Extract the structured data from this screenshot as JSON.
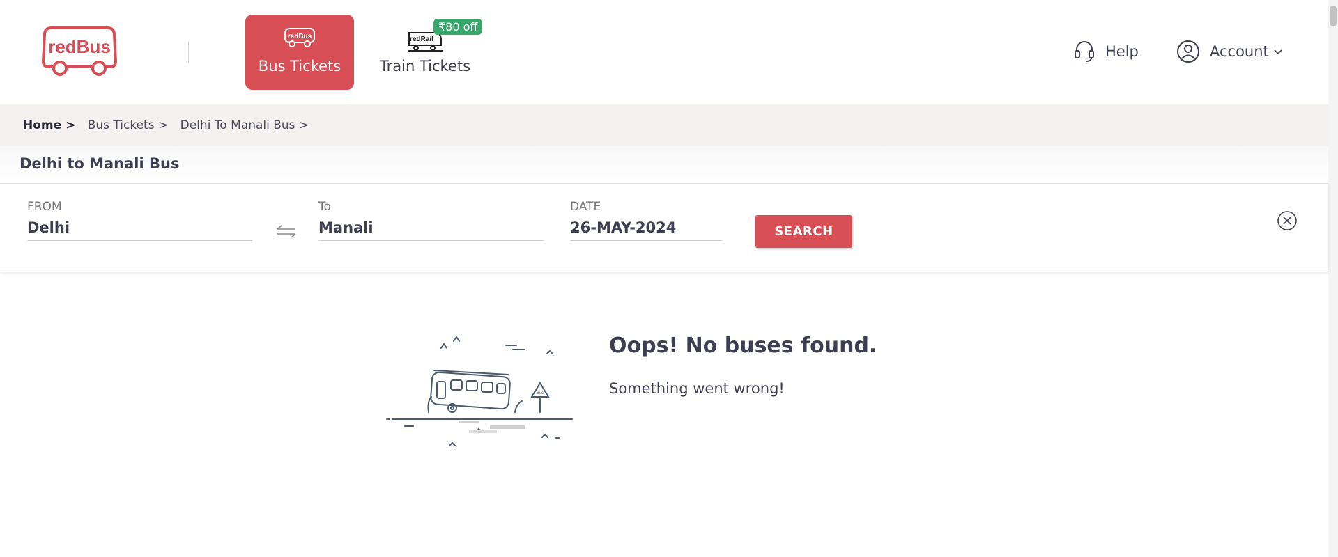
{
  "header": {
    "logo_text": "redBus",
    "tabs": [
      {
        "label": "Bus Tickets",
        "icon": "redbus-icon",
        "icon_text": "redBus"
      },
      {
        "label": "Train Tickets",
        "icon": "redrail-icon",
        "icon_text": "redRail"
      }
    ],
    "offer_badge": "₹80 off",
    "help_label": "Help",
    "account_label": "Account",
    "brand_color": "#d84e55",
    "offer_color": "#39a66b"
  },
  "breadcrumb": {
    "items": [
      "Home >",
      "Bus Tickets >",
      "Delhi To Manali Bus >"
    ]
  },
  "page_title": "Delhi to Manali Bus",
  "search": {
    "from_label": "FROM",
    "from_value": "Delhi",
    "to_label": "To",
    "to_value": "Manali",
    "date_label": "DATE",
    "date_value": "26-MAY-2024",
    "button_label": "SEARCH"
  },
  "empty_state": {
    "title": "Oops! No buses found.",
    "subtitle": "Something went wrong!",
    "illustration_text": "Bus"
  }
}
